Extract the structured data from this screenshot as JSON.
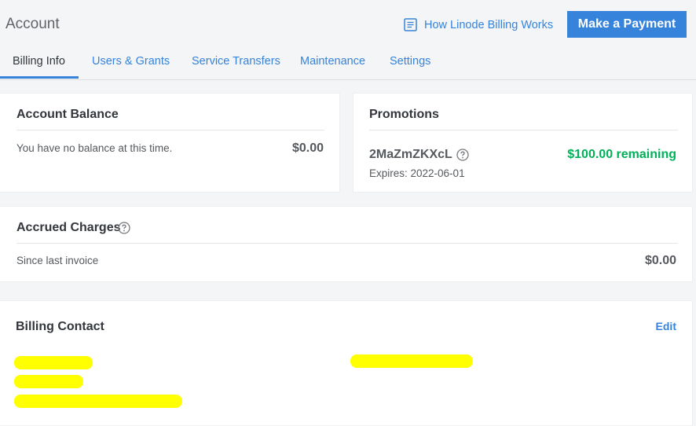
{
  "header": {
    "title": "Account",
    "help_link": "How Linode Billing Works",
    "pay_button": "Make a Payment"
  },
  "tabs": [
    {
      "label": "Billing Info",
      "active": true
    },
    {
      "label": "Users & Grants"
    },
    {
      "label": "Service Transfers"
    },
    {
      "label": "Maintenance"
    },
    {
      "label": "Settings"
    }
  ],
  "account_balance": {
    "title": "Account Balance",
    "message": "You have no balance at this time.",
    "amount": "$0.00"
  },
  "promotions": {
    "title": "Promotions",
    "code": "2MaZmZKXcL",
    "expires": "Expires: 2022-06-01",
    "remaining": "$100.00 remaining"
  },
  "accrued_charges": {
    "title": "Accrued Charges",
    "label": "Since last invoice",
    "amount": "$0.00"
  },
  "billing_contact": {
    "title": "Billing Contact",
    "edit_label": "Edit"
  },
  "colors": {
    "accent": "#3683dc",
    "success": "#00b159",
    "redaction": "#ffff00"
  }
}
